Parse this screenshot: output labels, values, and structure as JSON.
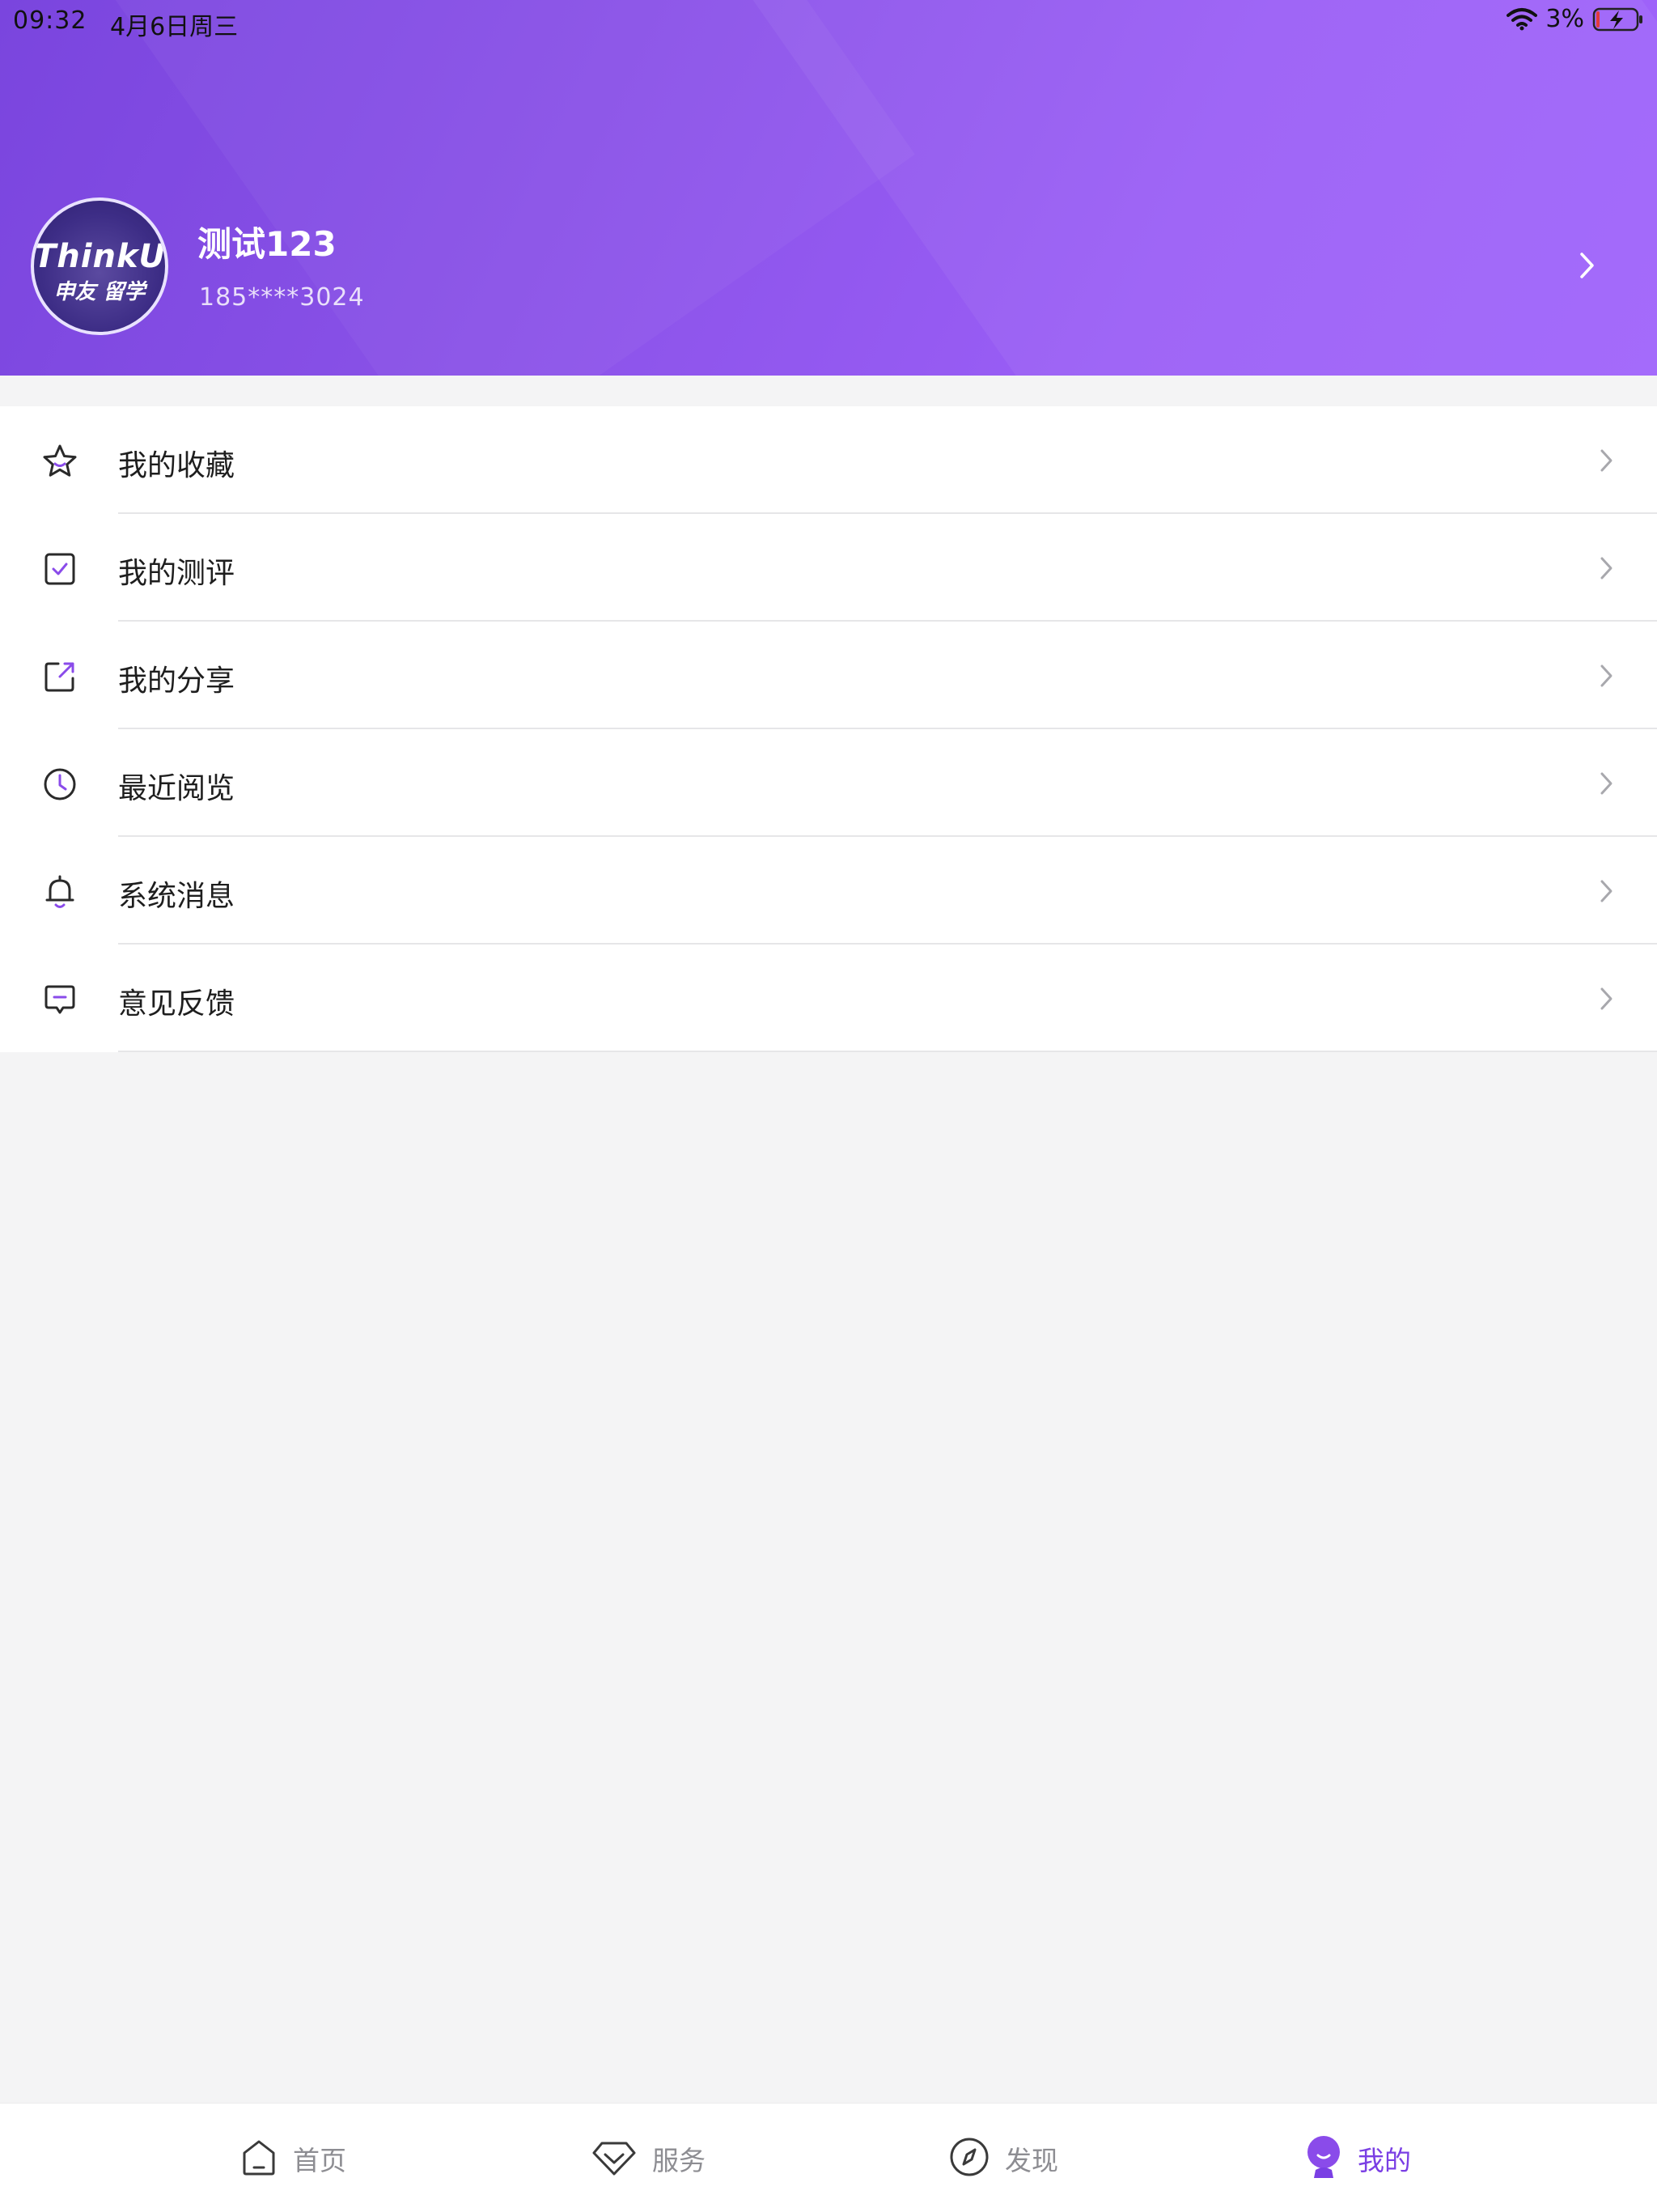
{
  "status_bar": {
    "time": "09:32",
    "date": "4月6日周三",
    "battery": "3%"
  },
  "profile": {
    "avatar_logo_top": "ThinkU",
    "avatar_logo_bottom": "申友 留学",
    "name": "测试123",
    "phone": "185****3024"
  },
  "menu": {
    "items": [
      {
        "label": "我的收藏",
        "icon": "star-icon"
      },
      {
        "label": "我的测评",
        "icon": "checkbox-icon"
      },
      {
        "label": "我的分享",
        "icon": "share-icon"
      },
      {
        "label": "最近阅览",
        "icon": "clock-icon"
      },
      {
        "label": "系统消息",
        "icon": "bell-icon"
      },
      {
        "label": "意见反馈",
        "icon": "feedback-icon"
      }
    ]
  },
  "tabbar": {
    "tabs": [
      {
        "label": "首页",
        "icon": "home-icon",
        "active": false
      },
      {
        "label": "服务",
        "icon": "diamond-icon",
        "active": false
      },
      {
        "label": "发现",
        "icon": "compass-icon",
        "active": false
      },
      {
        "label": "我的",
        "icon": "profile-icon",
        "active": true
      }
    ]
  },
  "colors": {
    "accent": "#7a3fe4",
    "header_start": "#7a45de",
    "header_end": "#a064fb"
  }
}
